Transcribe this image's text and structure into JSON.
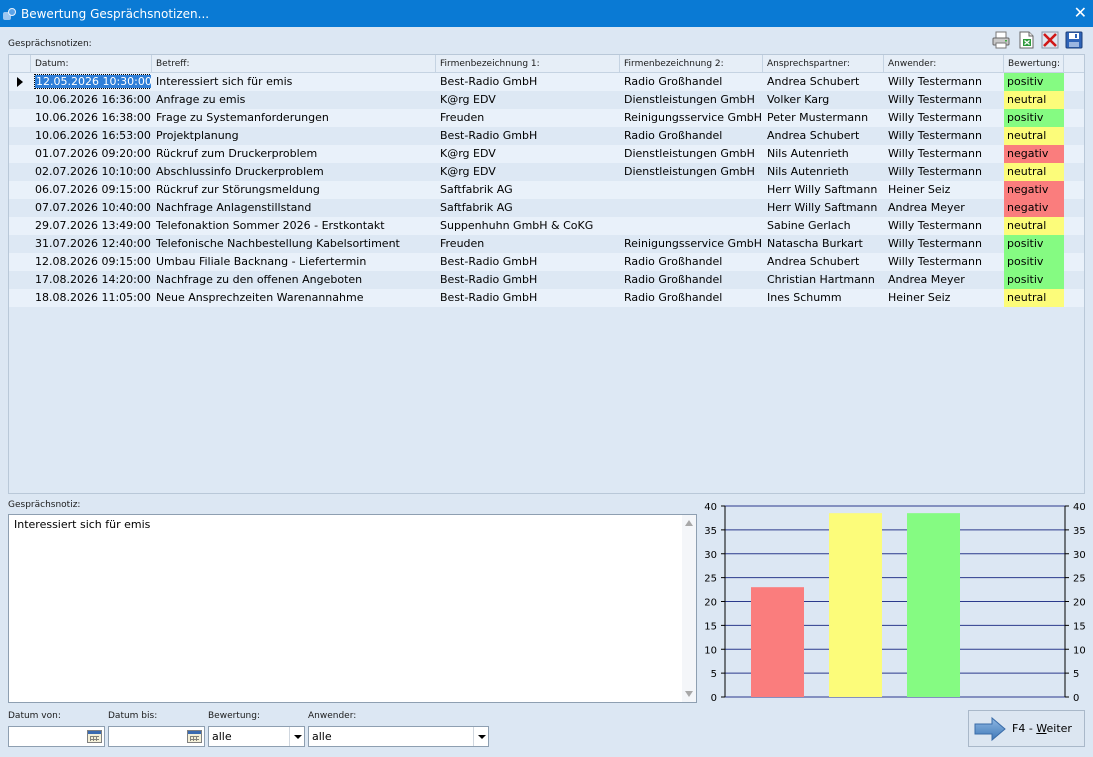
{
  "window": {
    "title": "Bewertung Gesprächsnotizen..."
  },
  "grid_label": "Gesprächsnotizen:",
  "toolbar": {
    "icons": [
      "printer-icon",
      "export-excel-icon",
      "delete-icon",
      "save-icon"
    ]
  },
  "columns": [
    "Datum:",
    "Betreff:",
    "Firmenbezeichnung 1:",
    "Firmenbezeichnung 2:",
    "Ansprechspartner:",
    "Anwender:",
    "Bewertung:"
  ],
  "rows": [
    {
      "datum": "12.05.2026 10:30:00",
      "betreff": "Interessiert sich für emis",
      "firma1": "Best-Radio GmbH",
      "firma2": "Radio Großhandel",
      "ansprech": "Andrea Schubert",
      "anwender": "Willy Testermann",
      "bewertung": "positiv"
    },
    {
      "datum": "10.06.2026 16:36:00",
      "betreff": "Anfrage zu emis",
      "firma1": "K@rg EDV",
      "firma2": "Dienstleistungen GmbH",
      "ansprech": "Volker Karg",
      "anwender": "Willy Testermann",
      "bewertung": "neutral"
    },
    {
      "datum": "10.06.2026 16:38:00",
      "betreff": "Frage zu Systemanforderungen",
      "firma1": "Freuden",
      "firma2": "Reinigungsservice GmbH",
      "ansprech": "Peter Mustermann",
      "anwender": "Willy Testermann",
      "bewertung": "positiv"
    },
    {
      "datum": "10.06.2026 16:53:00",
      "betreff": "Projektplanung",
      "firma1": "Best-Radio GmbH",
      "firma2": "Radio Großhandel",
      "ansprech": "Andrea Schubert",
      "anwender": "Willy Testermann",
      "bewertung": "neutral"
    },
    {
      "datum": "01.07.2026 09:20:00",
      "betreff": "Rückruf zum Druckerproblem",
      "firma1": "K@rg EDV",
      "firma2": "Dienstleistungen GmbH",
      "ansprech": "Nils Autenrieth",
      "anwender": "Willy Testermann",
      "bewertung": "negativ"
    },
    {
      "datum": "02.07.2026 10:10:00",
      "betreff": "Abschlussinfo Druckerproblem",
      "firma1": "K@rg EDV",
      "firma2": "Dienstleistungen GmbH",
      "ansprech": "Nils Autenrieth",
      "anwender": "Willy Testermann",
      "bewertung": "neutral"
    },
    {
      "datum": "06.07.2026 09:15:00",
      "betreff": "Rückruf zur Störungsmeldung",
      "firma1": "Saftfabrik AG",
      "firma2": "",
      "ansprech": "Herr Willy Saftmann",
      "anwender": "Heiner Seiz",
      "bewertung": "negativ"
    },
    {
      "datum": "07.07.2026 10:40:00",
      "betreff": "Nachfrage Anlagenstillstand",
      "firma1": "Saftfabrik AG",
      "firma2": "",
      "ansprech": "Herr Willy Saftmann",
      "anwender": "Andrea Meyer",
      "bewertung": "negativ"
    },
    {
      "datum": "29.07.2026 13:49:00",
      "betreff": "Telefonaktion Sommer 2026 - Erstkontakt",
      "firma1": "Suppenhuhn GmbH & CoKG",
      "firma2": "",
      "ansprech": "Sabine Gerlach",
      "anwender": "Willy Testermann",
      "bewertung": "neutral"
    },
    {
      "datum": "31.07.2026 12:40:00",
      "betreff": "Telefonische Nachbestellung Kabelsortiment",
      "firma1": "Freuden",
      "firma2": "Reinigungsservice GmbH",
      "ansprech": "Natascha Burkart",
      "anwender": "Willy Testermann",
      "bewertung": "positiv"
    },
    {
      "datum": "12.08.2026 09:15:00",
      "betreff": "Umbau Filiale Backnang - Liefertermin",
      "firma1": "Best-Radio GmbH",
      "firma2": "Radio Großhandel",
      "ansprech": "Andrea Schubert",
      "anwender": "Willy Testermann",
      "bewertung": "positiv"
    },
    {
      "datum": "17.08.2026 14:20:00",
      "betreff": "Nachfrage zu den offenen Angeboten",
      "firma1": "Best-Radio GmbH",
      "firma2": "Radio Großhandel",
      "ansprech": "Christian Hartmann",
      "anwender": "Andrea Meyer",
      "bewertung": "positiv"
    },
    {
      "datum": "18.08.2026 11:05:00",
      "betreff": "Neue Ansprechzeiten Warenannahme",
      "firma1": "Best-Radio GmbH",
      "firma2": "Radio Großhandel",
      "ansprech": "Ines Schumm",
      "anwender": "Heiner Seiz",
      "bewertung": "neutral"
    }
  ],
  "note": {
    "label": "Gesprächsnotiz:",
    "text": "Interessiert sich für emis"
  },
  "colors": {
    "positiv": "#85fb82",
    "neutral": "#fcfc7a",
    "negativ": "#fa7d7d",
    "titlebar": "#0a7ad4",
    "grid_line": "#2b3a8c"
  },
  "chart_data": {
    "type": "bar",
    "categories": [
      "negativ",
      "neutral",
      "positiv"
    ],
    "values": [
      23,
      38.5,
      38.5
    ],
    "colors": [
      "#fa7d7d",
      "#fcfc7a",
      "#85fb82"
    ],
    "ylim": [
      0,
      40
    ],
    "yticks": [
      0,
      5,
      10,
      15,
      20,
      25,
      30,
      35,
      40
    ],
    "grid": true,
    "left_axis": true,
    "right_axis": true
  },
  "filters": {
    "datum_von": {
      "label": "Datum von:",
      "value": ""
    },
    "datum_bis": {
      "label": "Datum bis:",
      "value": ""
    },
    "bewertung": {
      "label": "Bewertung:",
      "value": "alle"
    },
    "anwender": {
      "label": "Anwender:",
      "value": "alle"
    }
  },
  "weiter_button": {
    "key": "F4 - ",
    "underlined": "W",
    "rest": "eiter"
  }
}
